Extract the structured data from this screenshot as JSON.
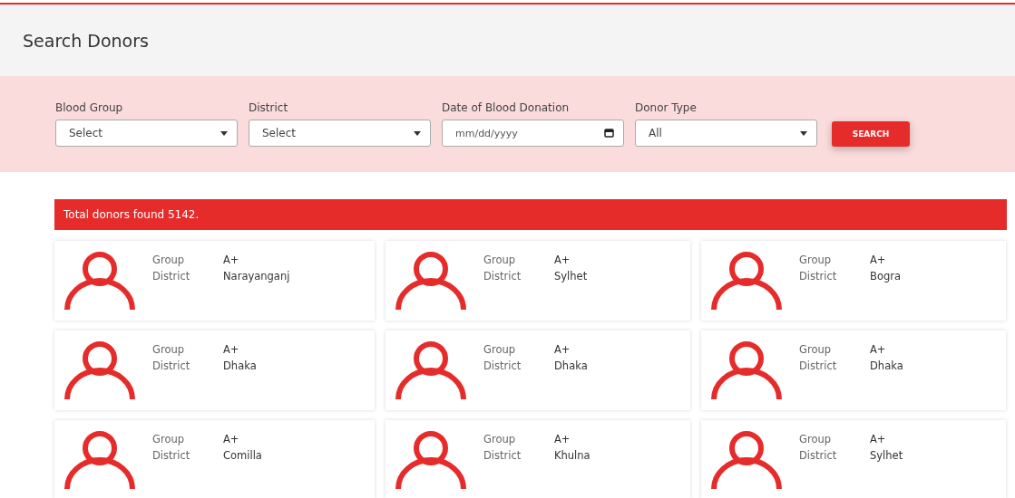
{
  "header": {
    "title": "Search Donors"
  },
  "filters": [
    {
      "kind": "select",
      "label": "Blood Group",
      "value": "Select"
    },
    {
      "kind": "select",
      "label": "District",
      "value": "Select"
    },
    {
      "kind": "date",
      "label": "Date of Blood Donation",
      "placeholder": "mm/dd/yyyy"
    },
    {
      "kind": "select",
      "label": "Donor Type",
      "value": "All"
    }
  ],
  "search_button": "SEARCH",
  "results_banner": "Total donors found 5142.",
  "donors": [
    {
      "group_label": "Group",
      "group": "A+",
      "district_label": "District",
      "district": "Narayanganj"
    },
    {
      "group_label": "Group",
      "group": "A+",
      "district_label": "District",
      "district": "Sylhet"
    },
    {
      "group_label": "Group",
      "group": "A+",
      "district_label": "District",
      "district": "Bogra"
    },
    {
      "group_label": "Group",
      "group": "A+",
      "district_label": "District",
      "district": "Dhaka"
    },
    {
      "group_label": "Group",
      "group": "A+",
      "district_label": "District",
      "district": "Dhaka"
    },
    {
      "group_label": "Group",
      "group": "A+",
      "district_label": "District",
      "district": "Dhaka"
    },
    {
      "group_label": "Group",
      "group": "A+",
      "district_label": "District",
      "district": "Comilla"
    },
    {
      "group_label": "Group",
      "group": "A+",
      "district_label": "District",
      "district": "Khulna"
    },
    {
      "group_label": "Group",
      "group": "A+",
      "district_label": "District",
      "district": "Sylhet"
    }
  ]
}
